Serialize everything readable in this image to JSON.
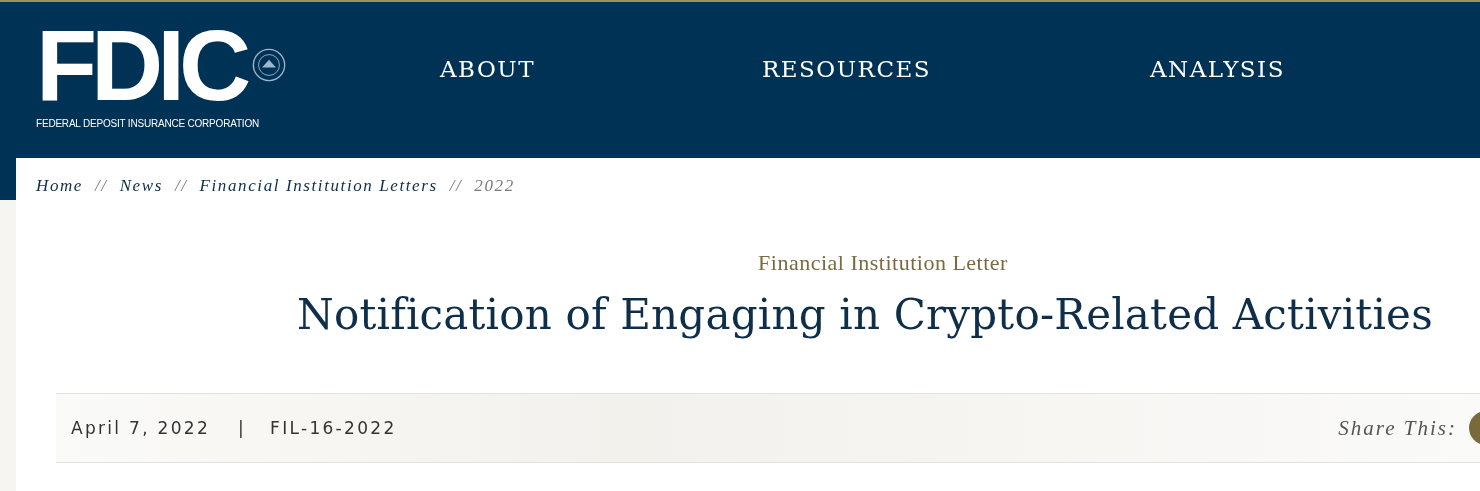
{
  "logo": {
    "wordmark": "FDIC",
    "tagline": "FEDERAL DEPOSIT INSURANCE CORPORATION"
  },
  "nav": [
    {
      "label": "ABOUT"
    },
    {
      "label": "RESOURCES"
    },
    {
      "label": "ANALYSIS"
    }
  ],
  "breadcrumb": [
    {
      "label": "Home",
      "kind": "link"
    },
    {
      "label": "News",
      "kind": "link"
    },
    {
      "label": "Financial Institution Letters",
      "kind": "link"
    },
    {
      "label": "2022",
      "kind": "current"
    }
  ],
  "breadcrumb_separator": "//",
  "eyebrow": "Financial Institution Letter",
  "title": "Notification of Engaging in Crypto-Related Activities",
  "meta": {
    "date": "April 7, 2022",
    "separator": "|",
    "id": "FIL-16-2022",
    "share_label": "Share This:"
  }
}
